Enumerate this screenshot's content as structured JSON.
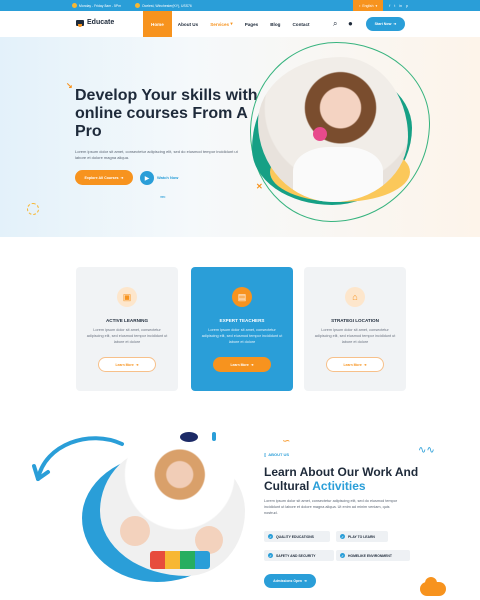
{
  "topbar": {
    "hours": "Monday - Friday 8am - 5Pm",
    "address": "Ocelest, Winchester(KY), USS76",
    "language": "English",
    "social": [
      "f",
      "t",
      "in",
      "p"
    ]
  },
  "nav": {
    "brand": "Educate",
    "items": [
      {
        "label": "Home"
      },
      {
        "label": "About Us"
      },
      {
        "label": "Services"
      },
      {
        "label": "Pages"
      },
      {
        "label": "Blog"
      },
      {
        "label": "Contact"
      }
    ],
    "start_label": "Start Now"
  },
  "hero": {
    "title": "Develop Your  skills with online courses From A Pro",
    "subtitle": "Lorem ipsum dolor sit amet, consectetur adipiscing elit, sed do eiusmod tempor incididunt ut labore et dolore magna aliqua.",
    "explore_label": "Explore All Courses",
    "watch_label": "Watch Now"
  },
  "features": [
    {
      "title": "ACTIVE LEARNING",
      "desc": "Lorem ipsum dolor sit amet, consectetur adipiscing elit, sed eiusmod tempor incididunt ut labore et dolore",
      "button": "Learn More"
    },
    {
      "title": "EXPERT TEACHERS",
      "desc": "Lorem ipsum dolor sit amet, consectetur adipiscing elit, sed eiusmod tempor incididunt ut labore et dolore",
      "button": "Learn More"
    },
    {
      "title": "STRATEGI LOCATION",
      "desc": "Lorem ipsum dolor sit amet, consectetur adipiscing elit, sed eiusmod tempor incididunt ut labore et dolore",
      "button": "Learn More"
    }
  ],
  "about": {
    "tag": "ABOUT US",
    "title_main": "Learn About Our Work And Cultural ",
    "title_highlight": "Activities",
    "text": "Lorem ipsum dolor sit amet, consectetur adipiscing elit, sed do eiusmod tempor incididunt ut labore et dolore magna aliqua. Ut enim ad minim veniam, quis nostrud.",
    "pills": [
      "QUALITY EDUCATIONS",
      "PLAY TO LEARN",
      "SAFETY AND SECURITY",
      "HOMELIKE ENVIRONMENT"
    ],
    "button": "Admissions Open"
  },
  "colors": {
    "primary_blue": "#2a9ed8",
    "accent_orange": "#f7931e",
    "dark": "#1e2a3a"
  }
}
